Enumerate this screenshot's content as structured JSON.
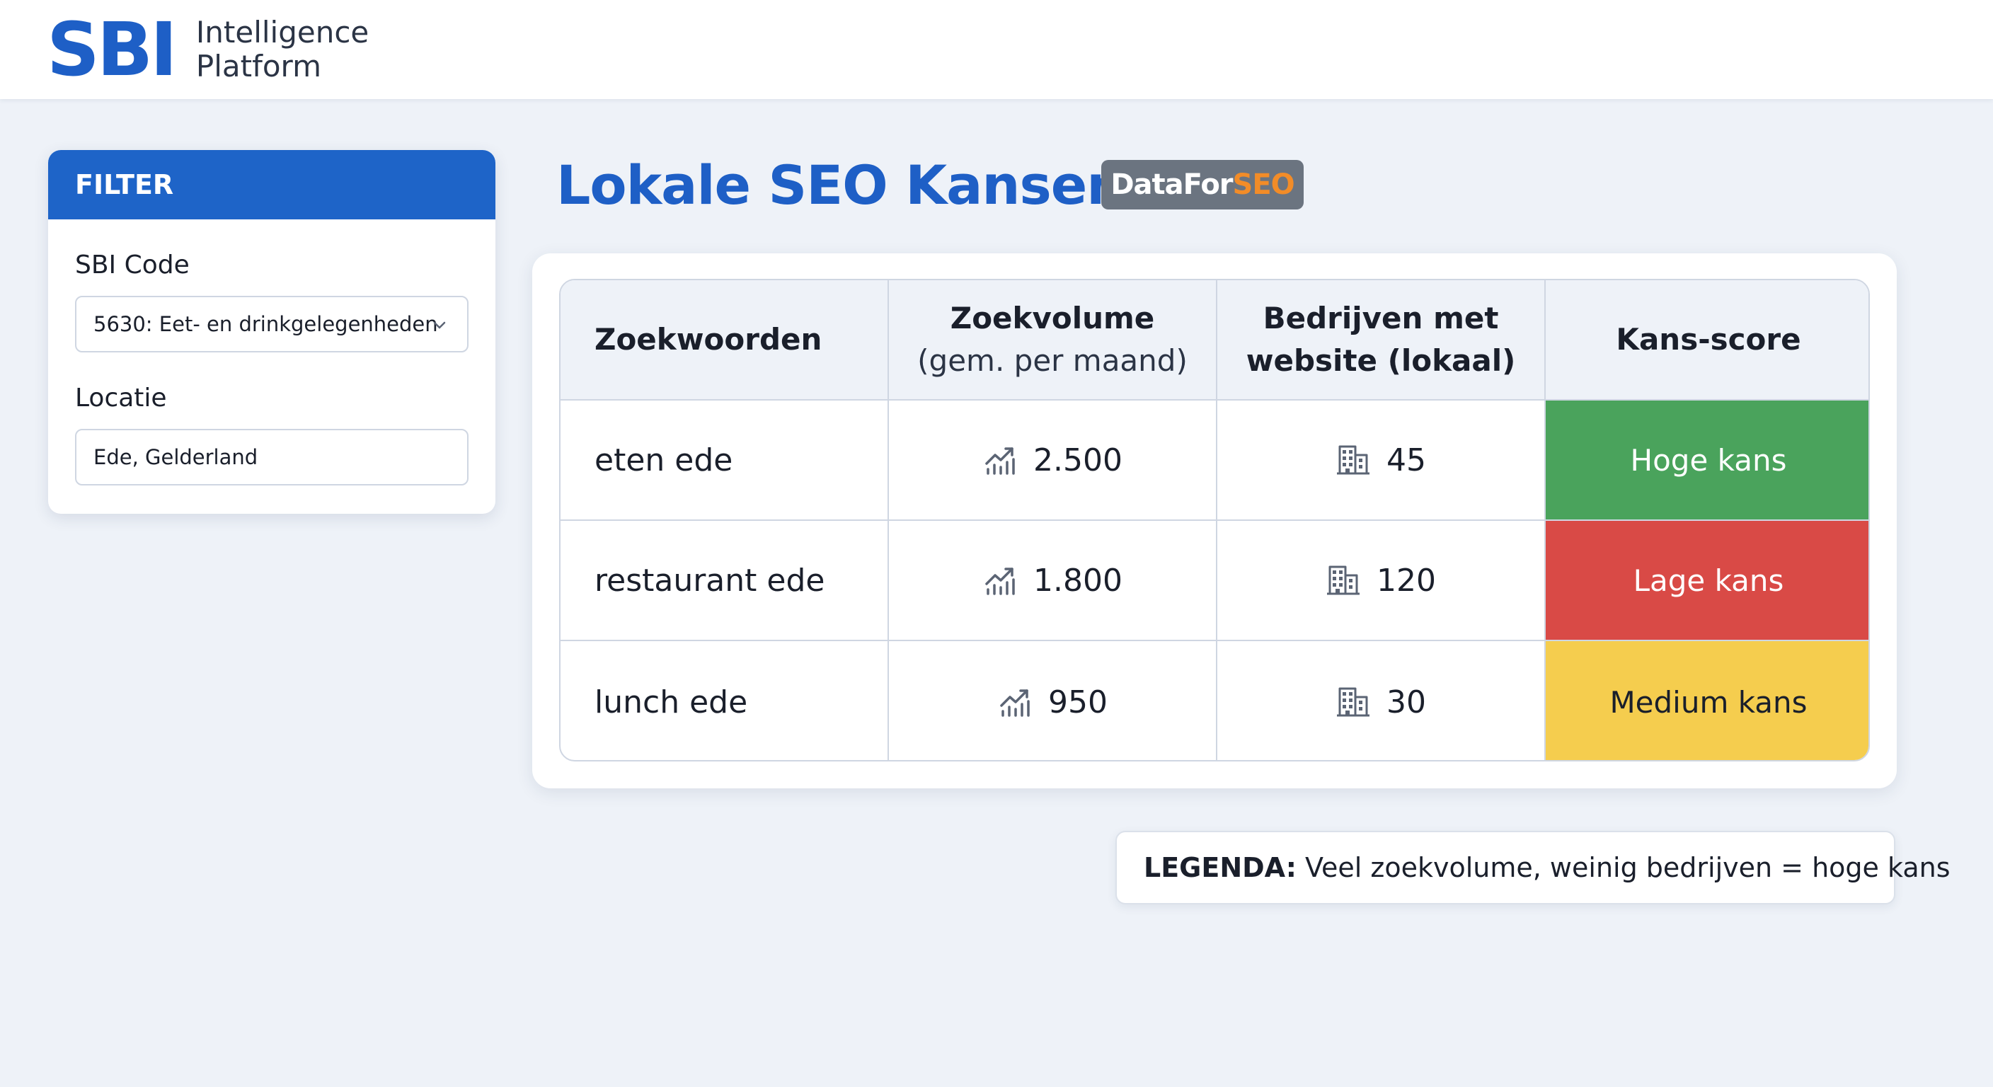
{
  "app": {
    "logo_mark": "SBI",
    "logo_line1": "Intelligence",
    "logo_line2": "Platform"
  },
  "filter": {
    "header": "FILTER",
    "sbi_label": "SBI Code",
    "sbi_value": "5630: Eet- en drinkgelegenheden",
    "location_label": "Locatie",
    "location_value": "Ede, Gelderland"
  },
  "page": {
    "title": "Lokale SEO Kansen",
    "badge_prefix": "DataFor",
    "badge_suffix": "SEO"
  },
  "table": {
    "headers": {
      "keywords": "Zoekwoorden",
      "volume_main": "Zoekvolume",
      "volume_sub": "(gem. per maand)",
      "companies_line1": "Bedrijven met",
      "companies_line2": "website (lokaal)",
      "score": "Kans-score"
    },
    "rows": [
      {
        "keyword": "eten ede",
        "volume": "2.500",
        "companies": "45",
        "score": "Hoge kans",
        "score_level": "high"
      },
      {
        "keyword": "restaurant ede",
        "volume": "1.800",
        "companies": "120",
        "score": "Lage kans",
        "score_level": "low"
      },
      {
        "keyword": "lunch ede",
        "volume": "950",
        "companies": "30",
        "score": "Medium kans",
        "score_level": "medium"
      }
    ],
    "icons": {
      "volume": "trend-chart-icon",
      "companies": "building-icon"
    }
  },
  "legend": {
    "label": "LEGENDA:",
    "text": "Veel zoekvolume, weinig bedrijven = hoge kans"
  },
  "colors": {
    "brand_blue": "#1e5fc6",
    "high": "#4aa35c",
    "low": "#d94a46",
    "medium": "#f5cd4e",
    "badge_bg": "#6b7480",
    "badge_accent": "#f28c28"
  }
}
